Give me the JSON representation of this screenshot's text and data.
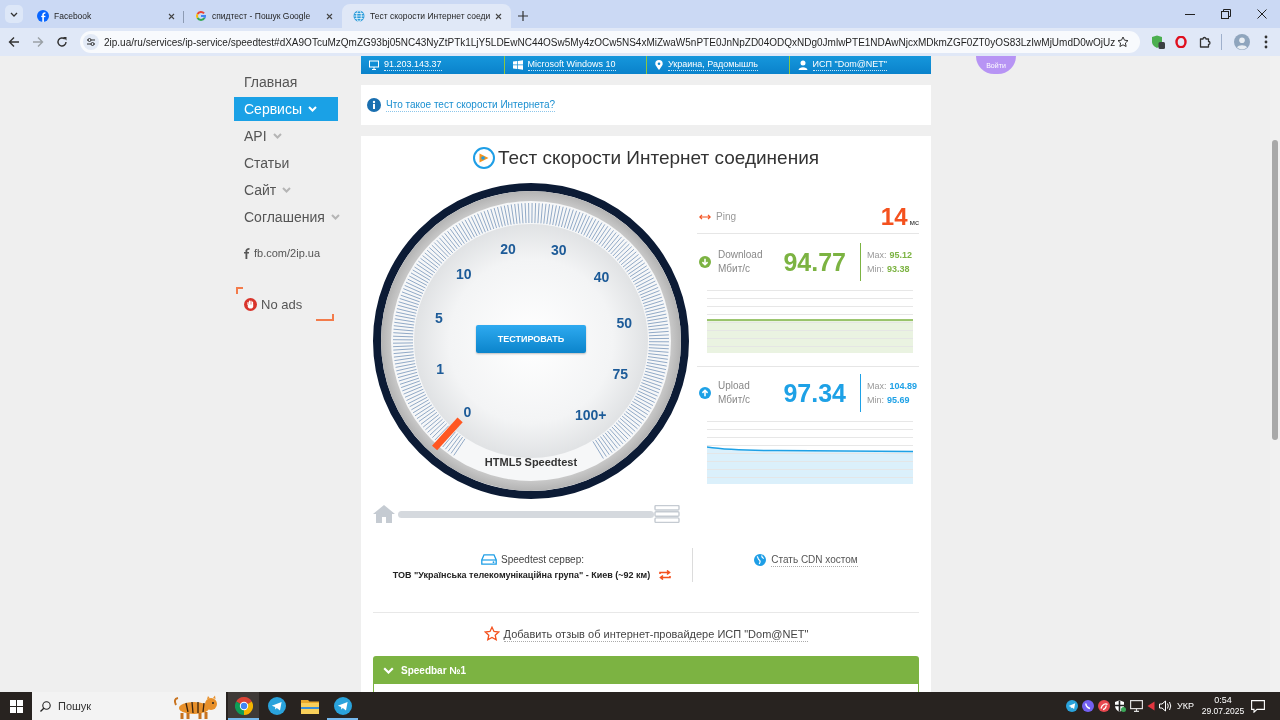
{
  "browser": {
    "tabs": [
      {
        "kind": "social",
        "title": "Facebook",
        "selected": false
      },
      {
        "kind": "search",
        "title": "спидтест - Пошук Google",
        "selected": false
      },
      {
        "kind": "web",
        "title": "Тест скорости Интернет соеди",
        "selected": true
      }
    ],
    "url": "2ip.ua/ru/services/ip-service/speedtest#dXA9OTcuMzQmZG93bj05NC43NyZtPTk1LjY5LDEwNC44OSw5My4zOCw5NS4xMiZwaW5nPTE0JnNpZD04ODQxNDg0JmlwPTE1NDAwNjcxMDkmZGF0ZT0yOS83LzIwMjUmdD0wOjUz"
  },
  "page": {
    "ip_bar": [
      {
        "kind": "ip",
        "text": "91.203.143.37"
      },
      {
        "kind": "os",
        "text": "Microsoft Windows 10"
      },
      {
        "kind": "location",
        "text": "Украина, Радомышль"
      },
      {
        "kind": "provider",
        "text": "ИСП \"Dom@NET\""
      }
    ],
    "login": "Войти",
    "nav": [
      {
        "label": "Главная",
        "selected": false,
        "has_submenu": false
      },
      {
        "label": "Сервисы",
        "selected": true,
        "has_submenu": true
      },
      {
        "label": "API",
        "selected": false,
        "has_submenu": true
      },
      {
        "label": "Статьи",
        "selected": false,
        "has_submenu": false
      },
      {
        "label": "Сайт",
        "selected": false,
        "has_submenu": true
      },
      {
        "label": "Соглашения",
        "selected": false,
        "has_submenu": true
      }
    ],
    "social_link": "fb.com/2ip.ua",
    "no_ads": "No ads",
    "info_link": "Что такое тест скорости Интернета?",
    "speedtest": {
      "title": "Тест скорости Интернет соединения",
      "gauge": {
        "scale": [
          "0",
          "1",
          "5",
          "10",
          "20",
          "30",
          "40",
          "50",
          "75",
          "100+"
        ],
        "button": "ТЕСТИРОВАТЬ",
        "caption": "HTML5 Speedtest"
      },
      "ping": {
        "label": "Ping",
        "value": "14",
        "unit": "мс"
      },
      "results": [
        {
          "kind": "download",
          "label": "Download",
          "unit": "Мбит/с",
          "value": "94.77",
          "max_label": "Max:",
          "max": "95.12",
          "min_label": "Min:",
          "min": "93.38",
          "color": "#7cb342"
        },
        {
          "kind": "upload",
          "label": "Upload",
          "unit": "Мбит/с",
          "value": "97.34",
          "max_label": "Max:",
          "max": "104.89",
          "min_label": "Min:",
          "min": "95.69",
          "color": "#1ea1e6"
        }
      ],
      "server": {
        "label": "Speedtest сервер:",
        "name": "ТОВ \"Українська телекомунікаційна група\" - Киев (~92 км)"
      },
      "cdn_link": "Стать CDN хостом",
      "review_link": "Добавить отзыв об интернет-провайдере ИСП \"Dom@NET\"",
      "speedbar": {
        "title": "Speedbar №1",
        "expanded": true
      }
    }
  },
  "taskbar": {
    "search": {
      "placeholder": "Пошук"
    },
    "apps": [
      {
        "kind": "browser",
        "selected": true,
        "running": true
      },
      {
        "kind": "messenger",
        "selected": false,
        "running": false
      },
      {
        "kind": "files",
        "selected": false,
        "running": false
      },
      {
        "kind": "messenger",
        "selected": false,
        "running": true
      }
    ],
    "language": "УКР",
    "time": "0:54",
    "date": "29.07.2025"
  }
}
